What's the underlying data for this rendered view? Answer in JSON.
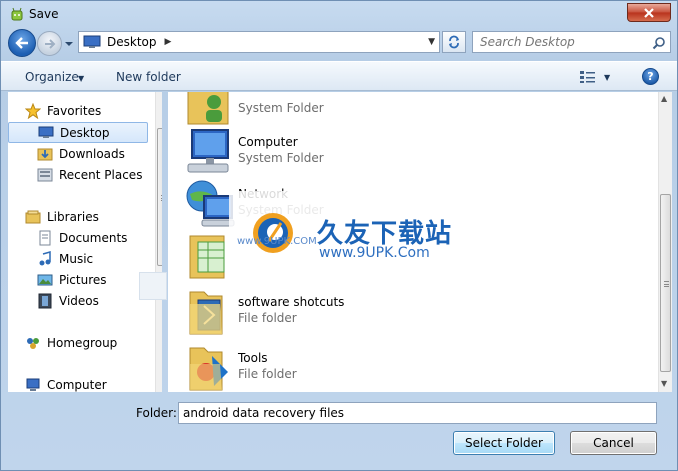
{
  "window": {
    "title": "Save"
  },
  "address": {
    "location": "Desktop"
  },
  "search": {
    "placeholder": "Search Desktop"
  },
  "toolbar": {
    "organize_label": "Organize",
    "new_folder_label": "New folder"
  },
  "sidebar": {
    "favorites_label": "Favorites",
    "favorites": [
      "Desktop",
      "Downloads",
      "Recent Places"
    ],
    "libraries_label": "Libraries",
    "libraries": [
      "Documents",
      "Music",
      "Pictures",
      "Videos"
    ],
    "homegroup_label": "Homegroup",
    "computer_label": "Computer",
    "selected": "Desktop"
  },
  "items": [
    {
      "name": "",
      "type": "System Folder"
    },
    {
      "name": "Computer",
      "type": "System Folder"
    },
    {
      "name": "Network",
      "type": "System Folder"
    },
    {
      "name": "",
      "type": ""
    },
    {
      "name": "software shotcuts",
      "type": "File folder"
    },
    {
      "name": "Tools",
      "type": "File folder"
    }
  ],
  "watermark": {
    "text_cn": "久友下载站",
    "url": "www.9UPK.Com",
    "url_small": "www.9UPK.COM"
  },
  "footer": {
    "folder_label": "Folder:",
    "folder_value": "android data recovery files",
    "select_label": "Select Folder",
    "cancel_label": "Cancel"
  },
  "colors": {
    "accent": "#1d5fb3",
    "selection_bg": "#d5e7fb",
    "close_red": "#c7503a"
  }
}
